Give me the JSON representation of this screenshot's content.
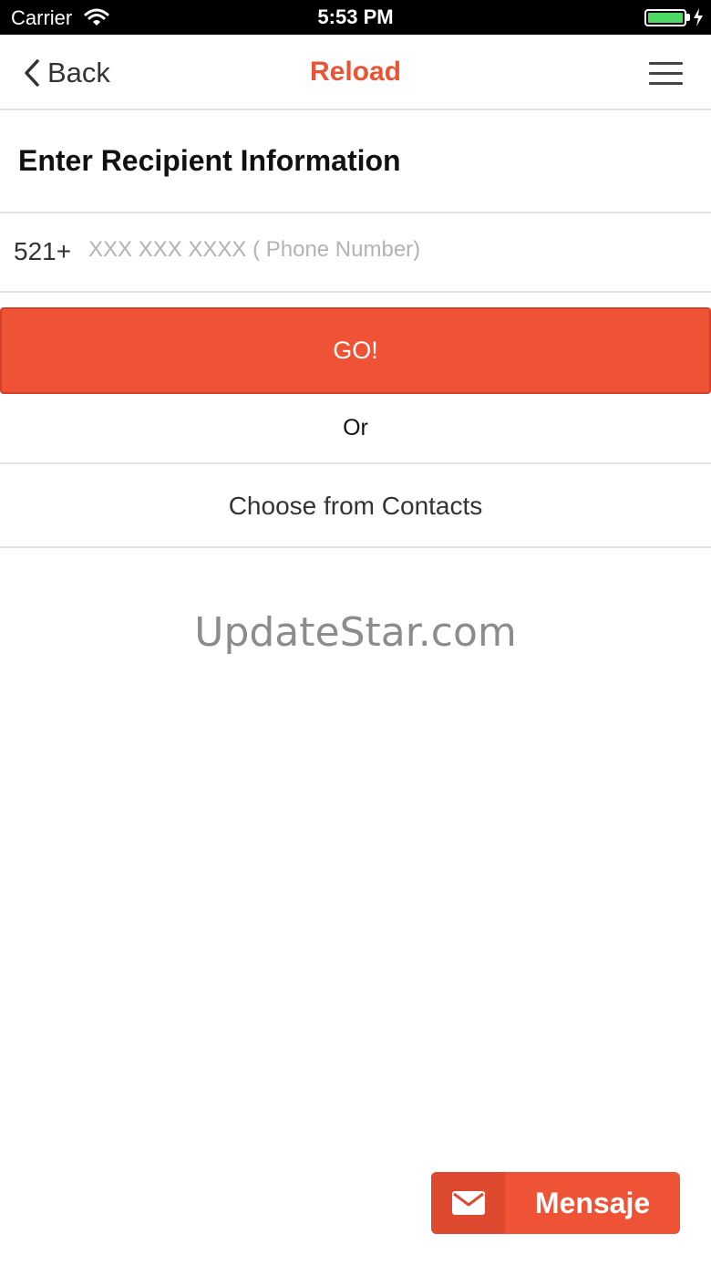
{
  "status_bar": {
    "carrier": "Carrier",
    "time": "5:53 PM",
    "wifi_icon": "wifi-icon",
    "battery_icon": "battery-icon",
    "charging_icon": "charging-bolt-icon"
  },
  "nav": {
    "back_label": "Back",
    "title": "Reload",
    "back_icon": "chevron-left-icon",
    "menu_icon": "hamburger-menu-icon"
  },
  "form": {
    "section_title": "Enter Recipient Information",
    "country_code": "521+",
    "phone_value": "",
    "phone_placeholder": "XXX XXX XXXX ( Phone Number)",
    "go_label": "GO!",
    "or_label": "Or",
    "contacts_label": "Choose from Contacts"
  },
  "watermark": "UpdateStar.com",
  "message_button": {
    "label": "Mensaje",
    "icon": "envelope-icon"
  },
  "colors": {
    "accent": "#ef5336",
    "title": "#ea5435",
    "battery": "#4cd964"
  }
}
